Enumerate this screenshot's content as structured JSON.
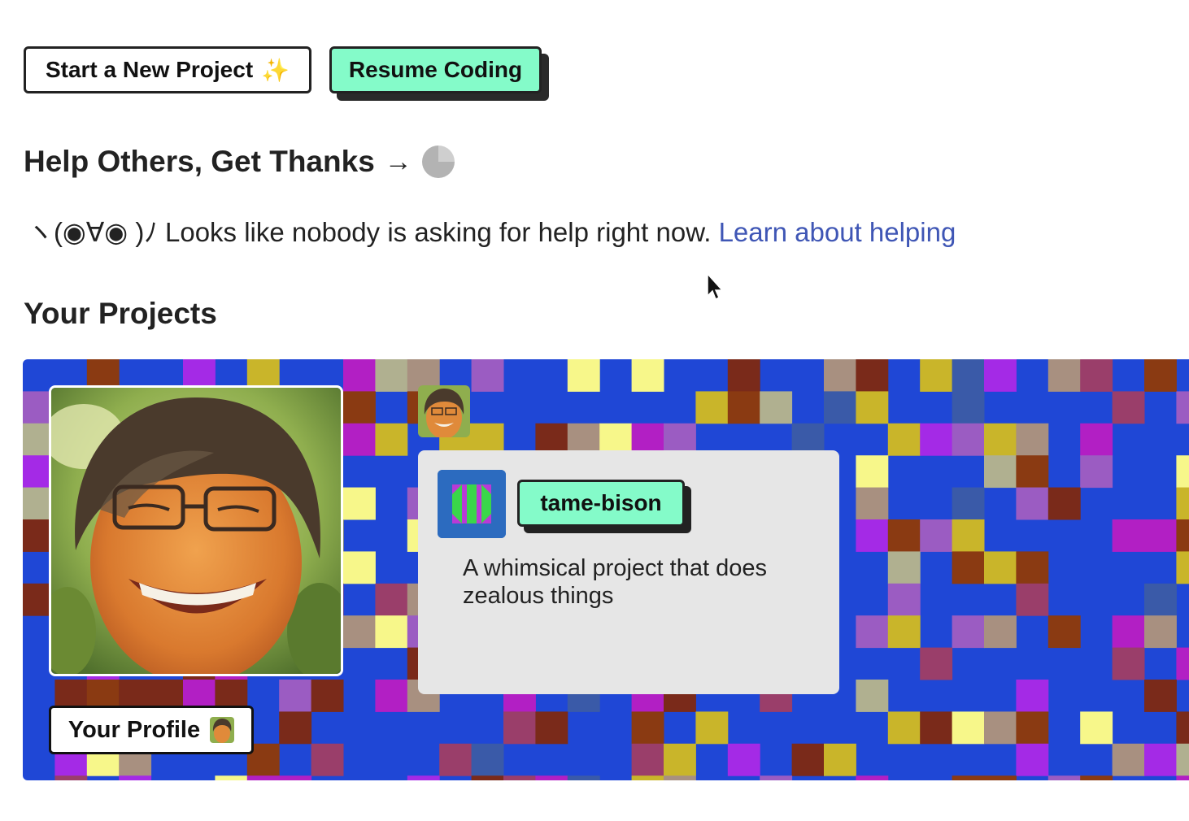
{
  "actions": {
    "new_project_label": "Start a New Project",
    "new_project_icon": "sparkles-icon",
    "resume_label": "Resume Coding",
    "accent_color": "#84fbc9"
  },
  "help": {
    "title": "Help Others, Get Thanks",
    "arrow": "→",
    "kaomoji": "ヽ(◉∀◉ )ﾉ",
    "message": "Looks like nobody is asking for help right now.",
    "link_label": "Learn about helping"
  },
  "projects": {
    "section_title": "Your Projects",
    "profile_button_label": "Your Profile",
    "project": {
      "name": "tame-bison",
      "description": "A whimsical project that does zealous things"
    }
  }
}
